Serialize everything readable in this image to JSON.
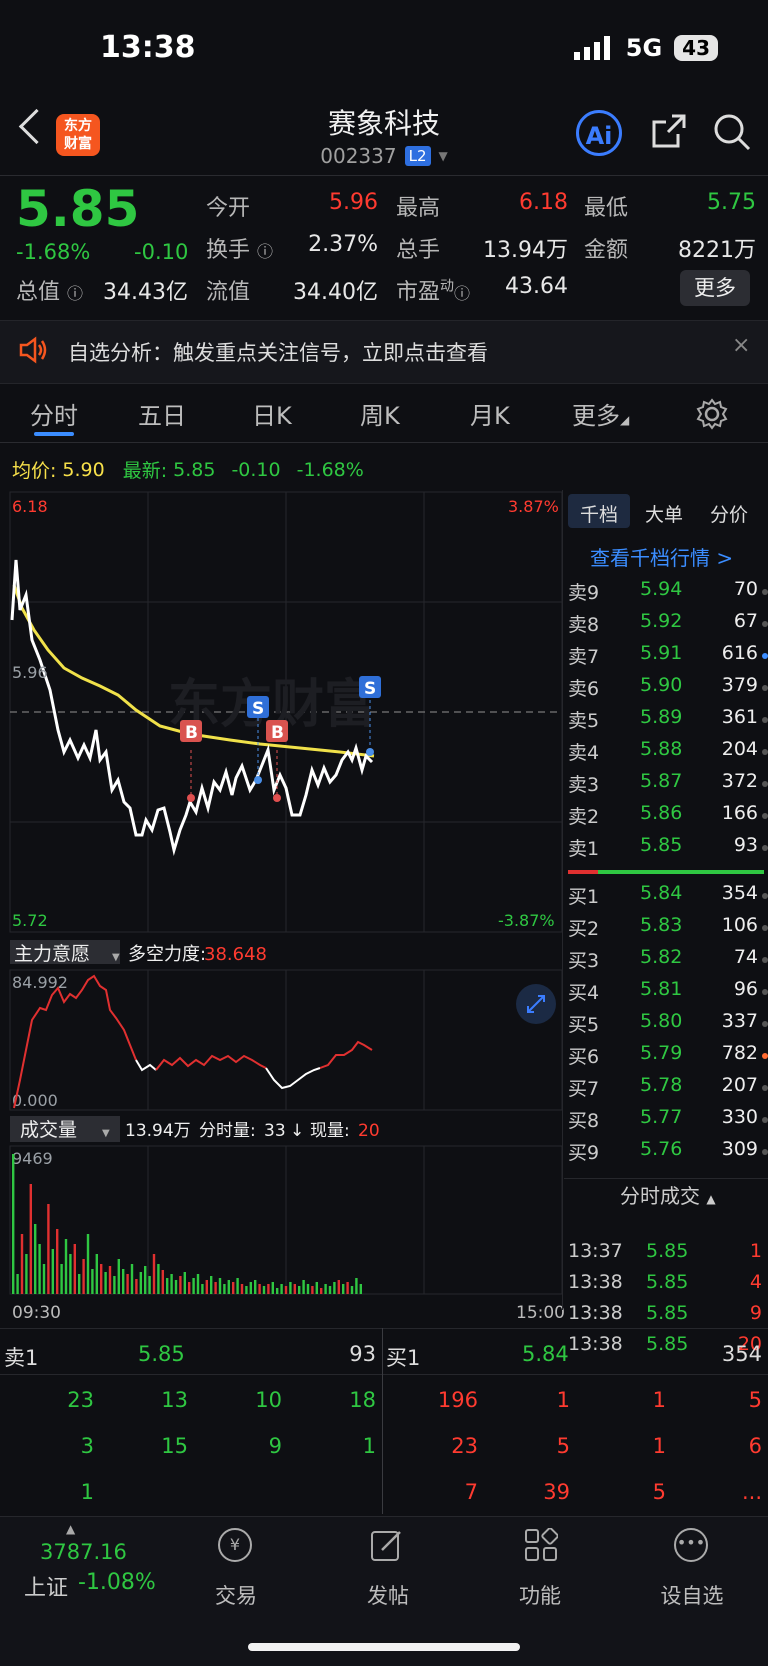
{
  "status": {
    "time": "13:38",
    "signal": "5G",
    "battery": "43"
  },
  "header": {
    "name": "赛象科技",
    "code": "002337",
    "badge": "L2",
    "logo_line1": "东方",
    "logo_line2": "财富",
    "ai_label": "Ai"
  },
  "quote": {
    "price": "5.85",
    "pct": "-1.68%",
    "chg": "-0.10",
    "open_label": "今开",
    "open": "5.96",
    "high_label": "最高",
    "high": "6.18",
    "low_label": "最低",
    "low": "5.75",
    "turnover_label": "换手",
    "turnover": "2.37%",
    "volume_label": "总手",
    "volume": "13.94万",
    "amount_label": "金额",
    "amount": "8221万",
    "mcap_label": "总值",
    "mcap": "34.43亿",
    "float_label": "流值",
    "float": "34.40亿",
    "pe_label": "市盈",
    "pe_sup": "动",
    "pe": "43.64",
    "more": "更多"
  },
  "notice": {
    "text": "自选分析：触发重点关注信号，立即点击查看",
    "close": "×"
  },
  "tabs": [
    "分时",
    "五日",
    "日K",
    "周K",
    "月K",
    "更多"
  ],
  "avg_row": {
    "avg_label": "均价:",
    "avg": "5.90",
    "latest_label": "最新:",
    "latest": "5.85",
    "chg": "-0.10",
    "pct": "-1.68%"
  },
  "chart": {
    "y_top": "6.18",
    "y_mid": "5.96",
    "y_bot": "5.72",
    "pct_top": "3.87%",
    "pct_bot": "-3.87%",
    "watermark": "东方财富",
    "markers": {
      "b": "B",
      "s": "S"
    },
    "indicator_label": "主力意愿",
    "force_label": "多空力度:",
    "force_value": "38.648",
    "ind_top": "84.992",
    "ind_bot": "0.000",
    "vol_label": "成交量",
    "vol_total": "13.94万",
    "vol_min_label": "分时量:",
    "vol_min": "33",
    "vol_arrow": "↓",
    "vol_now_label": "现量:",
    "vol_now": "20",
    "vol_max": "9469",
    "t_start": "09:30",
    "t_end": "15:00"
  },
  "orderbook": {
    "tabs": [
      "千档",
      "大单",
      "分价"
    ],
    "link": "查看千档行情 >",
    "asks": [
      {
        "label": "卖9",
        "price": "5.94",
        "vol": "70"
      },
      {
        "label": "卖8",
        "price": "5.92",
        "vol": "67"
      },
      {
        "label": "卖7",
        "price": "5.91",
        "vol": "616"
      },
      {
        "label": "卖6",
        "price": "5.90",
        "vol": "379"
      },
      {
        "label": "卖5",
        "price": "5.89",
        "vol": "361"
      },
      {
        "label": "卖4",
        "price": "5.88",
        "vol": "204"
      },
      {
        "label": "卖3",
        "price": "5.87",
        "vol": "372"
      },
      {
        "label": "卖2",
        "price": "5.86",
        "vol": "166"
      },
      {
        "label": "卖1",
        "price": "5.85",
        "vol": "93"
      }
    ],
    "bids": [
      {
        "label": "买1",
        "price": "5.84",
        "vol": "354"
      },
      {
        "label": "买2",
        "price": "5.83",
        "vol": "106"
      },
      {
        "label": "买3",
        "price": "5.82",
        "vol": "74"
      },
      {
        "label": "买4",
        "price": "5.81",
        "vol": "96"
      },
      {
        "label": "买5",
        "price": "5.80",
        "vol": "337"
      },
      {
        "label": "买6",
        "price": "5.79",
        "vol": "782"
      },
      {
        "label": "买7",
        "price": "5.78",
        "vol": "207"
      },
      {
        "label": "买8",
        "price": "5.77",
        "vol": "330"
      },
      {
        "label": "买9",
        "price": "5.76",
        "vol": "309"
      }
    ],
    "trades_title": "分时成交",
    "trades": [
      {
        "time": "13:37",
        "price": "5.85",
        "vol": "1"
      },
      {
        "time": "13:38",
        "price": "5.85",
        "vol": "4"
      },
      {
        "time": "13:38",
        "price": "5.85",
        "vol": "9"
      },
      {
        "time": "13:38",
        "price": "5.85",
        "vol": "20"
      }
    ]
  },
  "levels": {
    "sell_label": "卖1",
    "sell_price": "5.85",
    "sell_vol": "93",
    "buy_label": "买1",
    "buy_price": "5.84",
    "buy_vol": "354",
    "sell_grid": [
      [
        "23",
        "13",
        "10",
        "18"
      ],
      [
        "3",
        "15",
        "9",
        "1"
      ],
      [
        "1",
        "",
        "",
        ""
      ]
    ],
    "buy_grid": [
      [
        "196",
        "1",
        "1",
        "5"
      ],
      [
        "23",
        "5",
        "1",
        "6"
      ],
      [
        "7",
        "39",
        "5",
        "..."
      ]
    ]
  },
  "nav": {
    "index_value": "3787.16",
    "index_name": "上证",
    "index_pct": "-1.08%",
    "items": [
      "交易",
      "发帖",
      "功能",
      "设自选"
    ]
  }
}
